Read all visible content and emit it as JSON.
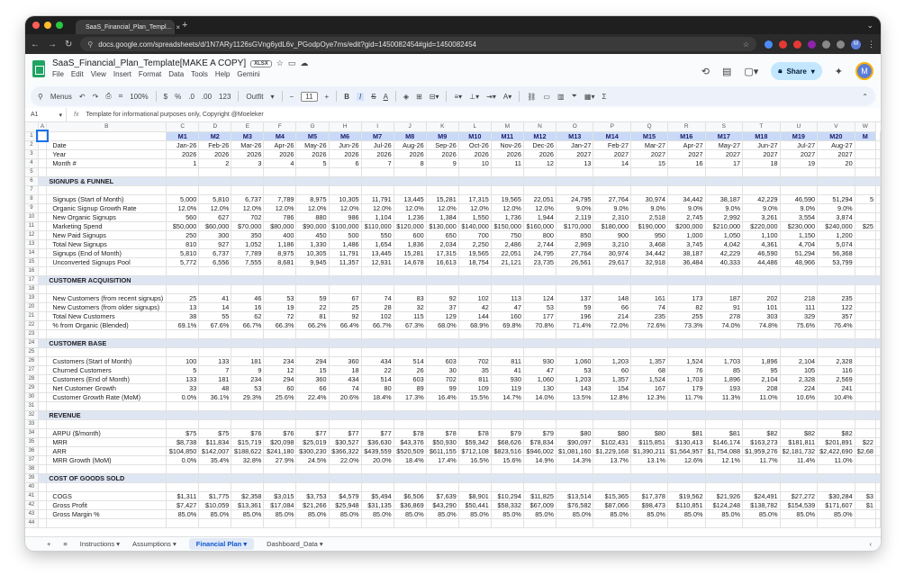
{
  "browser": {
    "tab_title": "SaaS_Financial_Plan_Templ...",
    "url": "docs.google.com/spreadsheets/d/1N7ARy1126sGVng6ydL6v_PGodpOye7ms/edit?gid=1450082454#gid=1450082454"
  },
  "doc": {
    "title": "SaaS_Financial_Plan_Template[MAKE A COPY]",
    "badge": "XLSX",
    "menus": [
      "File",
      "Edit",
      "View",
      "Insert",
      "Format",
      "Data",
      "Tools",
      "Help",
      "Gemini"
    ],
    "share_label": "Share",
    "avatar": "M"
  },
  "toolbar": {
    "menus_label": "Menus",
    "zoom": "100%",
    "currency": "$",
    "percent": "%",
    "dec_down": ".0",
    "dec_up": ".00",
    "num123": "123",
    "font": "Outfit",
    "font_size": "11"
  },
  "formula_bar": {
    "cell_ref": "A1",
    "fx": "fx",
    "content": "Template for informational purposes only, Copyright @Moeleker"
  },
  "columns": [
    "A",
    "B",
    "C",
    "D",
    "E",
    "F",
    "G",
    "H",
    "I",
    "J",
    "K",
    "L",
    "M",
    "N",
    "O",
    "P",
    "Q",
    "R",
    "S",
    "T",
    "U",
    "V",
    "W"
  ],
  "rows": [
    {
      "n": "1",
      "type": "mhead",
      "label": "",
      "cells": [
        "M1",
        "M2",
        "M3",
        "M4",
        "M5",
        "M6",
        "M7",
        "M8",
        "M9",
        "M10",
        "M11",
        "M12",
        "M13",
        "M14",
        "M15",
        "M16",
        "M17",
        "M18",
        "M19",
        "M20",
        "M"
      ]
    },
    {
      "n": "2",
      "type": "data",
      "label": "Date",
      "cells": [
        "Jan-26",
        "Feb-26",
        "Mar-26",
        "Apr-26",
        "May-26",
        "Jun-26",
        "Jul-26",
        "Aug-26",
        "Sep-26",
        "Oct-26",
        "Nov-26",
        "Dec-26",
        "Jan-27",
        "Feb-27",
        "Mar-27",
        "Apr-27",
        "May-27",
        "Jun-27",
        "Jul-27",
        "Aug-27",
        ""
      ]
    },
    {
      "n": "3",
      "type": "data",
      "label": "Year",
      "cells": [
        "2026",
        "2026",
        "2026",
        "2026",
        "2026",
        "2026",
        "2026",
        "2026",
        "2026",
        "2026",
        "2026",
        "2026",
        "2027",
        "2027",
        "2027",
        "2027",
        "2027",
        "2027",
        "2027",
        "2027",
        ""
      ]
    },
    {
      "n": "4",
      "type": "data",
      "label": "Month #",
      "cells": [
        "1",
        "2",
        "3",
        "4",
        "5",
        "6",
        "7",
        "8",
        "9",
        "10",
        "11",
        "12",
        "13",
        "14",
        "15",
        "16",
        "17",
        "18",
        "19",
        "20",
        ""
      ]
    },
    {
      "n": "5",
      "type": "blank",
      "label": "",
      "cells": []
    },
    {
      "n": "6",
      "type": "section",
      "label": "SIGNUPS & FUNNEL",
      "cells": []
    },
    {
      "n": "7",
      "type": "blank",
      "label": "",
      "cells": []
    },
    {
      "n": "8",
      "type": "data",
      "label": "Signups (Start of Month)",
      "cells": [
        "5,000",
        "5,810",
        "6,737",
        "7,789",
        "8,975",
        "10,305",
        "11,791",
        "13,445",
        "15,281",
        "17,315",
        "19,565",
        "22,051",
        "24,795",
        "27,764",
        "30,974",
        "34,442",
        "38,187",
        "42,229",
        "46,590",
        "51,294",
        "5"
      ]
    },
    {
      "n": "9",
      "type": "data",
      "label": "Organic Signup Growth Rate",
      "cells": [
        "12.0%",
        "12.0%",
        "12.0%",
        "12.0%",
        "12.0%",
        "12.0%",
        "12.0%",
        "12.0%",
        "12.0%",
        "12.0%",
        "12.0%",
        "12.0%",
        "9.0%",
        "9.0%",
        "9.0%",
        "9.0%",
        "9.0%",
        "9.0%",
        "9.0%",
        "9.0%",
        ""
      ]
    },
    {
      "n": "10",
      "type": "data",
      "label": "New Organic Signups",
      "cells": [
        "560",
        "627",
        "702",
        "786",
        "880",
        "986",
        "1,104",
        "1,236",
        "1,384",
        "1,550",
        "1,736",
        "1,944",
        "2,119",
        "2,310",
        "2,518",
        "2,745",
        "2,992",
        "3,261",
        "3,554",
        "3,874",
        ""
      ]
    },
    {
      "n": "11",
      "type": "data",
      "label": "Marketing Spend",
      "cells": [
        "$50,000",
        "$60,000",
        "$70,000",
        "$80,000",
        "$90,000",
        "$100,000",
        "$110,000",
        "$120,000",
        "$130,000",
        "$140,000",
        "$150,000",
        "$160,000",
        "$170,000",
        "$180,000",
        "$190,000",
        "$200,000",
        "$210,000",
        "$220,000",
        "$230,000",
        "$240,000",
        "$25"
      ]
    },
    {
      "n": "12",
      "type": "data",
      "label": "New Paid Signups",
      "cells": [
        "250",
        "300",
        "350",
        "400",
        "450",
        "500",
        "550",
        "600",
        "650",
        "700",
        "750",
        "800",
        "850",
        "900",
        "950",
        "1,000",
        "1,050",
        "1,100",
        "1,150",
        "1,200",
        ""
      ]
    },
    {
      "n": "13",
      "type": "data",
      "label": "Total New Signups",
      "cells": [
        "810",
        "927",
        "1,052",
        "1,186",
        "1,330",
        "1,486",
        "1,654",
        "1,836",
        "2,034",
        "2,250",
        "2,486",
        "2,744",
        "2,969",
        "3,210",
        "3,468",
        "3,745",
        "4,042",
        "4,361",
        "4,704",
        "5,074",
        ""
      ]
    },
    {
      "n": "14",
      "type": "data",
      "label": "Signups (End of Month)",
      "cells": [
        "5,810",
        "6,737",
        "7,789",
        "8,975",
        "10,305",
        "11,791",
        "13,445",
        "15,281",
        "17,315",
        "19,565",
        "22,051",
        "24,795",
        "27,764",
        "30,974",
        "34,442",
        "38,187",
        "42,229",
        "46,590",
        "51,294",
        "56,368",
        ""
      ]
    },
    {
      "n": "15",
      "type": "data",
      "label": "Unconverted Signups Pool",
      "cells": [
        "5,772",
        "6,556",
        "7,555",
        "8,681",
        "9,945",
        "11,357",
        "12,931",
        "14,678",
        "16,613",
        "18,754",
        "21,121",
        "23,735",
        "26,561",
        "29,617",
        "32,918",
        "36,484",
        "40,333",
        "44,486",
        "48,966",
        "53,799",
        ""
      ]
    },
    {
      "n": "16",
      "type": "blank",
      "label": "",
      "cells": []
    },
    {
      "n": "17",
      "type": "section",
      "label": "CUSTOMER ACQUISITION",
      "cells": []
    },
    {
      "n": "18",
      "type": "blank",
      "label": "",
      "cells": []
    },
    {
      "n": "19",
      "type": "data",
      "label": "New Customers (from recent signups)",
      "cells": [
        "25",
        "41",
        "46",
        "53",
        "59",
        "67",
        "74",
        "83",
        "92",
        "102",
        "113",
        "124",
        "137",
        "148",
        "161",
        "173",
        "187",
        "202",
        "218",
        "235",
        ""
      ]
    },
    {
      "n": "20",
      "type": "data",
      "label": "New Customers (from older signups)",
      "cells": [
        "13",
        "14",
        "16",
        "19",
        "22",
        "25",
        "28",
        "32",
        "37",
        "42",
        "47",
        "53",
        "59",
        "66",
        "74",
        "82",
        "91",
        "101",
        "111",
        "122",
        ""
      ]
    },
    {
      "n": "21",
      "type": "data",
      "label": "Total New Customers",
      "cells": [
        "38",
        "55",
        "62",
        "72",
        "81",
        "92",
        "102",
        "115",
        "129",
        "144",
        "160",
        "177",
        "196",
        "214",
        "235",
        "255",
        "278",
        "303",
        "329",
        "357",
        ""
      ]
    },
    {
      "n": "22",
      "type": "data",
      "label": "% from Organic (Blended)",
      "cells": [
        "69.1%",
        "67.6%",
        "66.7%",
        "66.3%",
        "66.2%",
        "66.4%",
        "66.7%",
        "67.3%",
        "68.0%",
        "68.9%",
        "69.8%",
        "70.8%",
        "71.4%",
        "72.0%",
        "72.6%",
        "73.3%",
        "74.0%",
        "74.8%",
        "75.6%",
        "76.4%",
        ""
      ]
    },
    {
      "n": "23",
      "type": "blank",
      "label": "",
      "cells": []
    },
    {
      "n": "24",
      "type": "section",
      "label": "CUSTOMER BASE",
      "cells": []
    },
    {
      "n": "25",
      "type": "blank",
      "label": "",
      "cells": []
    },
    {
      "n": "26",
      "type": "data",
      "label": "Customers (Start of Month)",
      "cells": [
        "100",
        "133",
        "181",
        "234",
        "294",
        "360",
        "434",
        "514",
        "603",
        "702",
        "811",
        "930",
        "1,060",
        "1,203",
        "1,357",
        "1,524",
        "1,703",
        "1,896",
        "2,104",
        "2,328",
        ""
      ]
    },
    {
      "n": "27",
      "type": "data",
      "label": "Churned Customers",
      "cells": [
        "5",
        "7",
        "9",
        "12",
        "15",
        "18",
        "22",
        "26",
        "30",
        "35",
        "41",
        "47",
        "53",
        "60",
        "68",
        "76",
        "85",
        "95",
        "105",
        "116",
        ""
      ]
    },
    {
      "n": "28",
      "type": "data",
      "label": "Customers (End of Month)",
      "cells": [
        "133",
        "181",
        "234",
        "294",
        "360",
        "434",
        "514",
        "603",
        "702",
        "811",
        "930",
        "1,060",
        "1,203",
        "1,357",
        "1,524",
        "1,703",
        "1,896",
        "2,104",
        "2,328",
        "2,569",
        ""
      ]
    },
    {
      "n": "29",
      "type": "data",
      "label": "Net Customer Growth",
      "cells": [
        "33",
        "48",
        "53",
        "60",
        "66",
        "74",
        "80",
        "89",
        "99",
        "109",
        "119",
        "130",
        "143",
        "154",
        "167",
        "179",
        "193",
        "208",
        "224",
        "241",
        ""
      ]
    },
    {
      "n": "30",
      "type": "data",
      "label": "Customer Growth Rate (MoM)",
      "cells": [
        "0.0%",
        "36.1%",
        "29.3%",
        "25.6%",
        "22.4%",
        "20.6%",
        "18.4%",
        "17.3%",
        "16.4%",
        "15.5%",
        "14.7%",
        "14.0%",
        "13.5%",
        "12.8%",
        "12.3%",
        "11.7%",
        "11.3%",
        "11.0%",
        "10.6%",
        "10.4%",
        ""
      ]
    },
    {
      "n": "31",
      "type": "blank",
      "label": "",
      "cells": []
    },
    {
      "n": "32",
      "type": "section",
      "label": "REVENUE",
      "cells": []
    },
    {
      "n": "33",
      "type": "blank",
      "label": "",
      "cells": []
    },
    {
      "n": "34",
      "type": "data",
      "label": "ARPU ($/month)",
      "cells": [
        "$75",
        "$75",
        "$76",
        "$76",
        "$77",
        "$77",
        "$77",
        "$78",
        "$78",
        "$78",
        "$79",
        "$79",
        "$80",
        "$80",
        "$80",
        "$81",
        "$81",
        "$82",
        "$82",
        "$82",
        ""
      ]
    },
    {
      "n": "35",
      "type": "data",
      "label": "MRR",
      "cells": [
        "$8,738",
        "$11,834",
        "$15,719",
        "$20,098",
        "$25,019",
        "$30,527",
        "$36,630",
        "$43,376",
        "$50,930",
        "$59,342",
        "$68,626",
        "$78,834",
        "$90,097",
        "$102,431",
        "$115,851",
        "$130,413",
        "$146,174",
        "$163,273",
        "$181,811",
        "$201,891",
        "$22"
      ]
    },
    {
      "n": "36",
      "type": "data",
      "label": "ARR",
      "cells": [
        "$104,850",
        "$142,007",
        "$188,622",
        "$241,180",
        "$300,230",
        "$366,322",
        "$439,559",
        "$520,509",
        "$611,155",
        "$712,108",
        "$823,516",
        "$946,002",
        "$1,081,160",
        "$1,229,168",
        "$1,390,211",
        "$1,564,957",
        "$1,754,088",
        "$1,959,276",
        "$2,181,732",
        "$2,422,690",
        "$2,68"
      ]
    },
    {
      "n": "37",
      "type": "data",
      "label": "MRR Growth (MoM)",
      "cells": [
        "0.0%",
        "35.4%",
        "32.8%",
        "27.9%",
        "24.5%",
        "22.0%",
        "20.0%",
        "18.4%",
        "17.4%",
        "16.5%",
        "15.6%",
        "14.9%",
        "14.3%",
        "13.7%",
        "13.1%",
        "12.6%",
        "12.1%",
        "11.7%",
        "11.4%",
        "11.0%",
        ""
      ]
    },
    {
      "n": "38",
      "type": "blank",
      "label": "",
      "cells": []
    },
    {
      "n": "39",
      "type": "section",
      "label": "COST OF GOODS SOLD",
      "cells": []
    },
    {
      "n": "40",
      "type": "blank",
      "label": "",
      "cells": []
    },
    {
      "n": "41",
      "type": "data",
      "label": "COGS",
      "cells": [
        "$1,311",
        "$1,775",
        "$2,358",
        "$3,015",
        "$3,753",
        "$4,579",
        "$5,494",
        "$6,506",
        "$7,639",
        "$8,901",
        "$10,294",
        "$11,825",
        "$13,514",
        "$15,365",
        "$17,378",
        "$19,562",
        "$21,926",
        "$24,491",
        "$27,272",
        "$30,284",
        "$3"
      ]
    },
    {
      "n": "42",
      "type": "data",
      "label": "Gross Profit",
      "cells": [
        "$7,427",
        "$10,059",
        "$13,361",
        "$17,084",
        "$21,266",
        "$25,948",
        "$31,135",
        "$36,869",
        "$43,290",
        "$50,441",
        "$58,332",
        "$67,009",
        "$76,582",
        "$87,066",
        "$98,473",
        "$110,851",
        "$124,248",
        "$138,782",
        "$154,539",
        "$171,607",
        "$1"
      ]
    },
    {
      "n": "43",
      "type": "data",
      "label": "Gross Margin %",
      "cells": [
        "85.0%",
        "85.0%",
        "85.0%",
        "85.0%",
        "85.0%",
        "85.0%",
        "85.0%",
        "85.0%",
        "85.0%",
        "85.0%",
        "85.0%",
        "85.0%",
        "85.0%",
        "85.0%",
        "85.0%",
        "85.0%",
        "85.0%",
        "85.0%",
        "85.0%",
        "85.0%",
        ""
      ]
    },
    {
      "n": "44",
      "type": "blank",
      "label": "",
      "cells": []
    }
  ],
  "sheets": {
    "add": "+",
    "list_icon": "≡",
    "tabs": [
      "Instructions",
      "Assumptions",
      "Financial Plan",
      "Dashboard_Data"
    ]
  }
}
